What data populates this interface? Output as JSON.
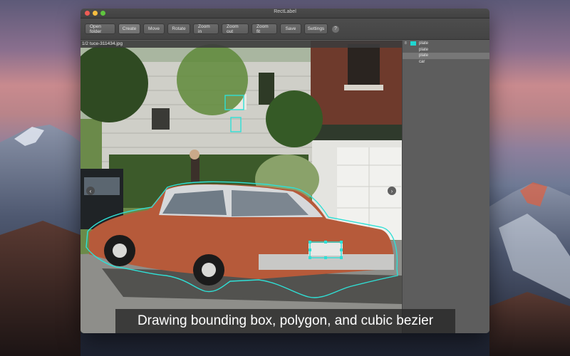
{
  "window": {
    "title": "RectLabel"
  },
  "toolbar": {
    "buttons": [
      {
        "label": "Open folder"
      },
      {
        "label": "Create"
      },
      {
        "label": "Move"
      },
      {
        "label": "Rotate"
      },
      {
        "label": "Zoom in"
      },
      {
        "label": "Zoom out"
      },
      {
        "label": "Zoom fit"
      },
      {
        "label": "Save"
      },
      {
        "label": "Settings"
      }
    ],
    "help_glyph": "?",
    "active_button": "Create"
  },
  "image_pane": {
    "file_label": "1/2 tuce-311434.jpg",
    "prev_glyph": "‹",
    "next_glyph": "›"
  },
  "labels": [
    {
      "text": "plate",
      "num": "8",
      "color": "#20d6d0",
      "selected": false
    },
    {
      "text": "plate",
      "num": "",
      "color": "",
      "selected": false
    },
    {
      "text": "plate",
      "num": "",
      "color": "",
      "selected": true
    },
    {
      "text": "car",
      "num": "",
      "color": "",
      "selected": false
    }
  ],
  "caption": "Drawing bounding box, polygon, and cubic bezier",
  "colors": {
    "annotation": "#2fe0d6",
    "window_bg": "#5d5d5d"
  }
}
